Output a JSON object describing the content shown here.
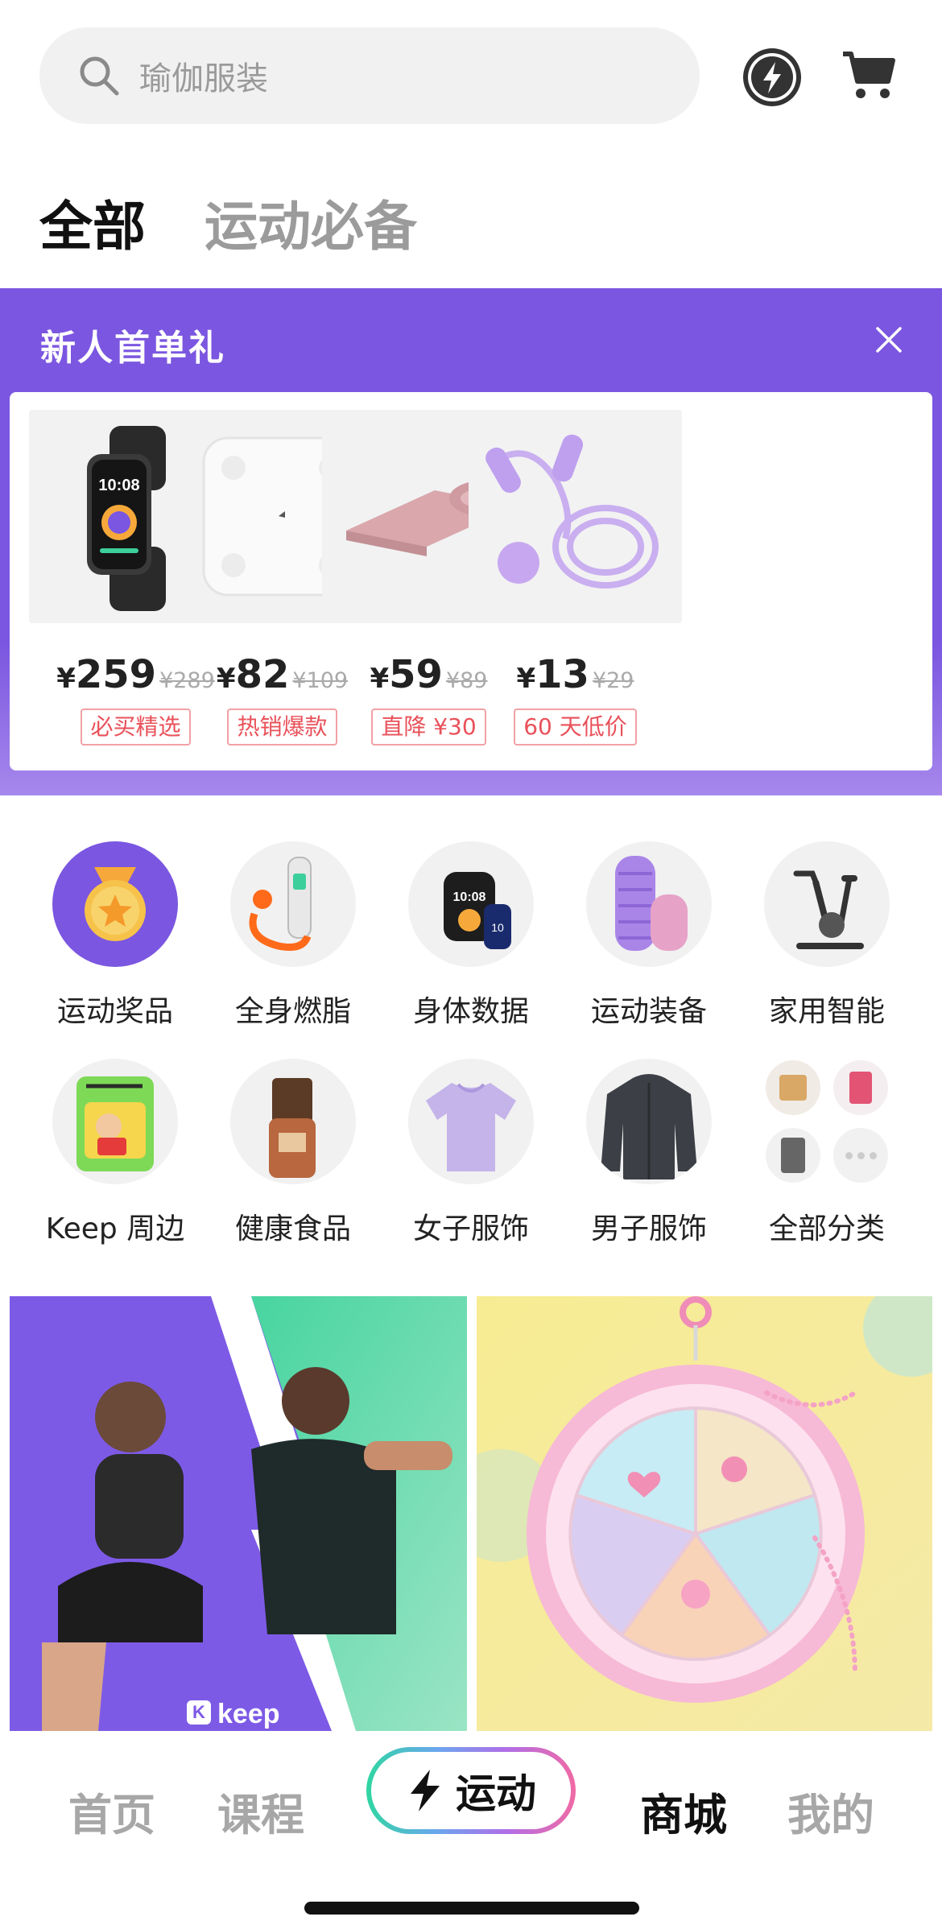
{
  "search": {
    "placeholder": "瑜伽服装"
  },
  "header": {
    "bolt_icon": "bolt-icon",
    "cart_icon": "cart-icon"
  },
  "tabs": [
    {
      "label": "全部",
      "active": true
    },
    {
      "label": "运动必备",
      "active": false
    }
  ],
  "new_user": {
    "title": "新人首单礼",
    "products": [
      {
        "name": "smartwatch",
        "currency": "¥",
        "price": "259",
        "old_price": "¥289",
        "tag": "必买精选"
      },
      {
        "name": "body-scale",
        "currency": "¥",
        "price": "82",
        "old_price": "¥109",
        "tag": "热销爆款"
      },
      {
        "name": "yoga-mat",
        "currency": "¥",
        "price": "59",
        "old_price": "¥89",
        "tag": "直降 ¥30"
      },
      {
        "name": "jump-rope",
        "currency": "¥",
        "price": "13",
        "old_price": "¥29",
        "tag": "60 天低价"
      }
    ]
  },
  "categories": [
    {
      "label": "运动奖品",
      "icon": "medal-icon"
    },
    {
      "label": "全身燃脂",
      "icon": "jump-rope-icon"
    },
    {
      "label": "身体数据",
      "icon": "watch-icon"
    },
    {
      "label": "运动装备",
      "icon": "foam-roller-icon"
    },
    {
      "label": "家用智能",
      "icon": "exercise-bike-icon"
    },
    {
      "label": "Keep 周边",
      "icon": "merch-icon"
    },
    {
      "label": "健康食品",
      "icon": "protein-bar-icon"
    },
    {
      "label": "女子服饰",
      "icon": "womens-shirt-icon"
    },
    {
      "label": "男子服饰",
      "icon": "mens-jacket-icon"
    },
    {
      "label": "全部分类",
      "icon": "all-categories-icon"
    }
  ],
  "promos": {
    "left_logo": "keep",
    "right_icon": "medal-charm-icon"
  },
  "bottom_nav": {
    "home": "首页",
    "course": "课程",
    "sport": "运动",
    "mall": "商城",
    "mine": "我的"
  },
  "colors": {
    "accent_purple": "#7b56e0",
    "accent_green": "#2fd6a2",
    "tag_red": "#e9515a"
  }
}
